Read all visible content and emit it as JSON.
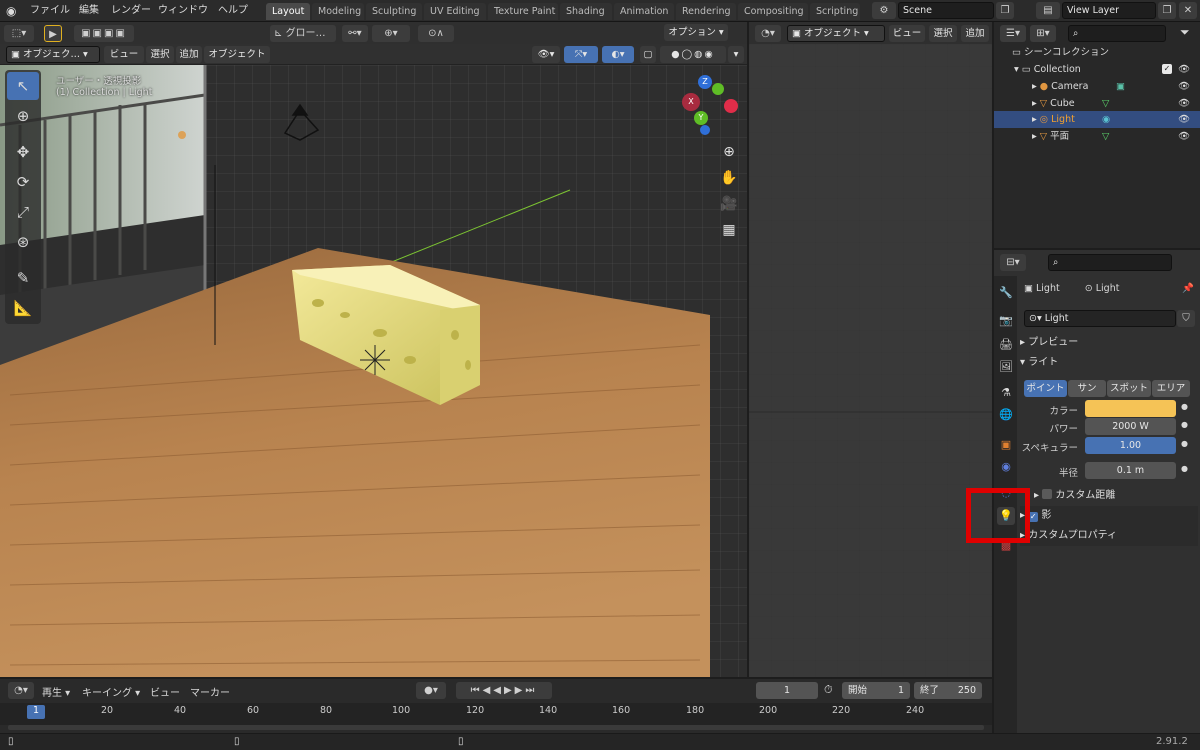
{
  "menu": {
    "file": "ファイル",
    "edit": "編集",
    "render": "レンダー",
    "window": "ウィンドウ",
    "help": "ヘルプ"
  },
  "workspaces": [
    "Layout",
    "Modeling",
    "Sculpting",
    "UV Editing",
    "Texture Paint",
    "Shading",
    "Animation",
    "Rendering",
    "Compositing",
    "Scripting"
  ],
  "scene_name": "Scene",
  "view_layer": "View Layer",
  "tool_header": {
    "transform": "グロー…"
  },
  "vp_header": {
    "mode": "オブジェク…",
    "view": "ビュー",
    "select": "選択",
    "add": "追加",
    "object": "オブジェクト",
    "options": "オプション"
  },
  "viewport_info": {
    "line1": "ユーザー・透視投影",
    "line2": "(1) Collection | Light"
  },
  "gizmo": {
    "x": "X",
    "y": "Y",
    "z": "Z"
  },
  "right_vp_header": {
    "mode": "オブジェクト",
    "view": "ビュー",
    "select": "選択",
    "add": "追加"
  },
  "outliner": {
    "scene_collection": "シーンコレクション",
    "items": [
      {
        "label": "Collection"
      },
      {
        "label": "Camera"
      },
      {
        "label": "Cube"
      },
      {
        "label": "Light"
      },
      {
        "label": "平面"
      }
    ]
  },
  "properties": {
    "breadcrumb_object": "Light",
    "breadcrumb_data": "Light",
    "datablock": "Light",
    "section_preview": "プレビュー",
    "section_light": "ライト",
    "light_types": [
      "ポイント",
      "サン",
      "スポット",
      "エリア"
    ],
    "color_label": "カラー",
    "color_value": "#f5c356",
    "power_label": "パワー",
    "power_value": "2000 W",
    "specular_label": "スペキュラー",
    "specular_value": "1.00",
    "radius_label": "半径",
    "radius_value": "0.1 m",
    "custom_distance": "カスタム距離",
    "shadow": "影",
    "custom_props": "カスタムプロパティ"
  },
  "timeline": {
    "playback": "再生",
    "keying": "キーイング",
    "view": "ビュー",
    "marker": "マーカー",
    "current_frame": "1",
    "start_label": "開始",
    "start_value": "1",
    "end_label": "終了",
    "end_value": "250",
    "ticks": [
      "1",
      "20",
      "40",
      "60",
      "80",
      "100",
      "120",
      "140",
      "160",
      "180",
      "200",
      "220",
      "240"
    ]
  },
  "status": {
    "version": "2.91.2"
  },
  "colors": {
    "accent": "#4772b3",
    "highlight": "#e00000"
  }
}
